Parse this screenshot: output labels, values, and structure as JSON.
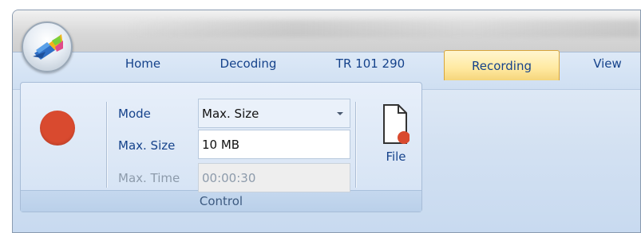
{
  "tabs": [
    {
      "label": "Home"
    },
    {
      "label": "Decoding"
    },
    {
      "label": "TR 101 290"
    },
    {
      "label": "Recording",
      "active": true
    },
    {
      "label": "View"
    }
  ],
  "control_group": {
    "caption": "Control",
    "mode": {
      "label": "Mode",
      "value": "Max. Size"
    },
    "max_size": {
      "label": "Max. Size",
      "value": "10 MB"
    },
    "max_time": {
      "label": "Max. Time",
      "value": "00:00:30",
      "disabled": true
    },
    "file_button": {
      "label": "File"
    }
  },
  "colors": {
    "record": "#d94a2f",
    "active_tab": "#ffe9a0",
    "label_text": "#15428b"
  }
}
